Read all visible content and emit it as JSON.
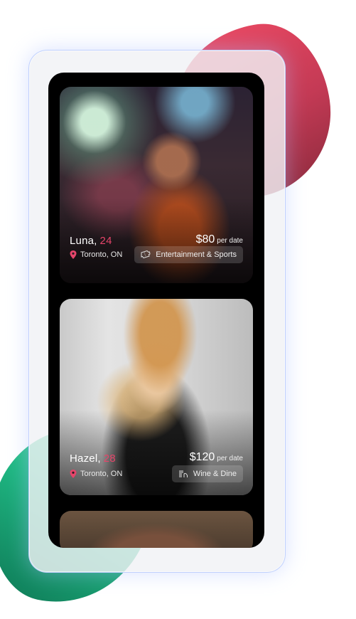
{
  "profiles": [
    {
      "name": "Luna,",
      "age": "24",
      "price": "$80",
      "price_unit": "per date",
      "location": "Toronto, ON",
      "category": "Entertainment & Sports",
      "category_icon": "ticket-icon"
    },
    {
      "name": "Hazel,",
      "age": "28",
      "price": "$120",
      "price_unit": "per date",
      "location": "Toronto, ON",
      "category": "Wine & Dine",
      "category_icon": "dining-icon"
    }
  ],
  "colors": {
    "accent": "#e6456a",
    "blob_red": "#ee4a64",
    "blob_green": "#1fb782"
  }
}
